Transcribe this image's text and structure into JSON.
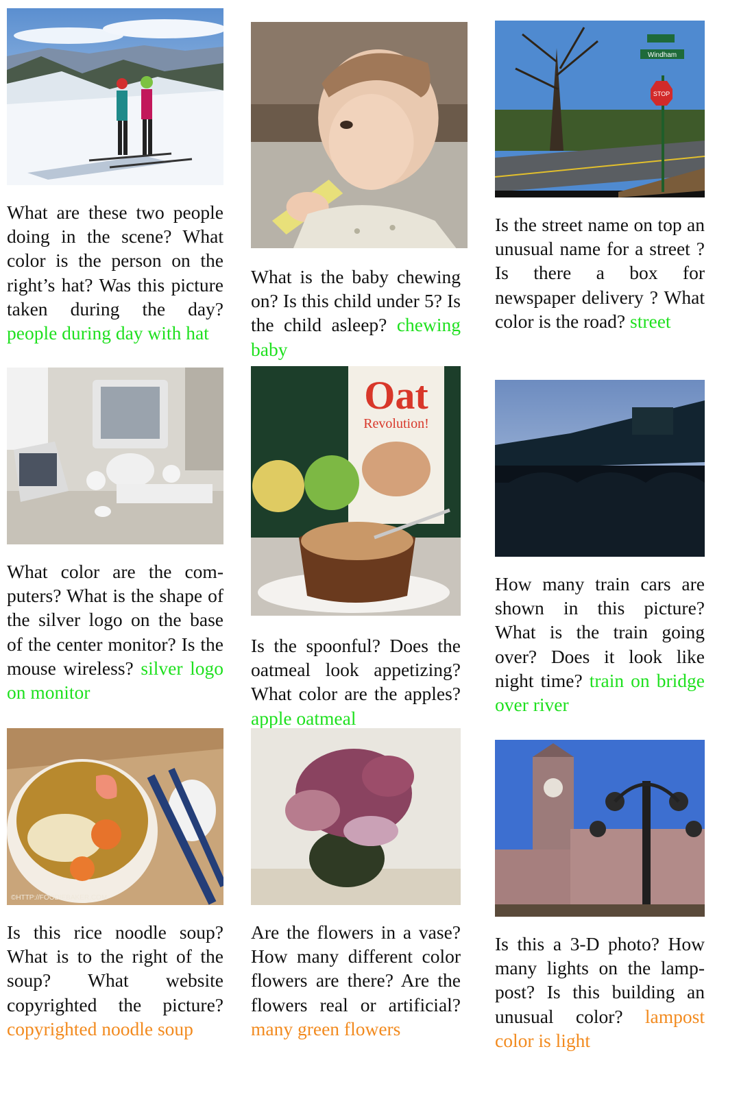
{
  "colors": {
    "green_tag": "#1ee01e",
    "orange_tag": "#f28a1e"
  },
  "items": [
    {
      "image": "skiers-on-mountain",
      "caption": "What are these two peo­ple doing in the scene? What color is the person on the right’s hat? Was this picture taken during the day?",
      "tag": "people during day with hat",
      "tag_color": "green"
    },
    {
      "image": "baby-chewing",
      "caption": "What is the baby chew­ing on? Is this child un­der 5? Is the child asleep?",
      "tag": "chewing baby",
      "tag_color": "green"
    },
    {
      "image": "street-with-stop-sign",
      "image_text": [
        "Windham",
        "STOP"
      ],
      "caption": "Is the street name on top an unusual name for a street ? Is there a box for newspaper delivery ? What color is the road?",
      "tag": "street",
      "tag_color": "green"
    },
    {
      "image": "computer-desk",
      "caption": "What color are the com­puters? What is the shape of the silver logo on the base of the center moni­tor? Is the mouse wire­less?",
      "tag": "silver logo on mon­itor",
      "tag_color": "green"
    },
    {
      "image": "oatmeal-and-apples",
      "image_text": [
        "Oat",
        "Revolution!"
      ],
      "caption": "Is the spoonful? Does the oatmeal look appetiz­ing? What color are the apples?",
      "tag": "apple oatmeal",
      "tag_color": "green"
    },
    {
      "image": "train-on-bridge",
      "caption": "How many train cars are shown in this picture? What is the train going over? Does it look like night time?",
      "tag": "train on bridge over river",
      "tag_color": "green"
    },
    {
      "image": "noodle-soup",
      "image_text": [
        "©HTTP://FOODIEBAKER.COM"
      ],
      "caption": "Is this rice noodle soup? What is to the right of the soup? What website copyrighted the picture?",
      "tag": "copyrighted noodle soup",
      "tag_color": "orange"
    },
    {
      "image": "flowers-in-vase",
      "caption": "Are the flowers in a vase? How many dif­ferent color flowers are there? Are the flowers real or artificial?",
      "tag": "many green flowers",
      "tag_color": "orange"
    },
    {
      "image": "3d-building-lamppost",
      "caption": "Is this a 3-D photo? How many lights on the lamp­post? Is this building an unusual color?",
      "tag": "lampost color is light",
      "tag_color": "orange"
    }
  ]
}
